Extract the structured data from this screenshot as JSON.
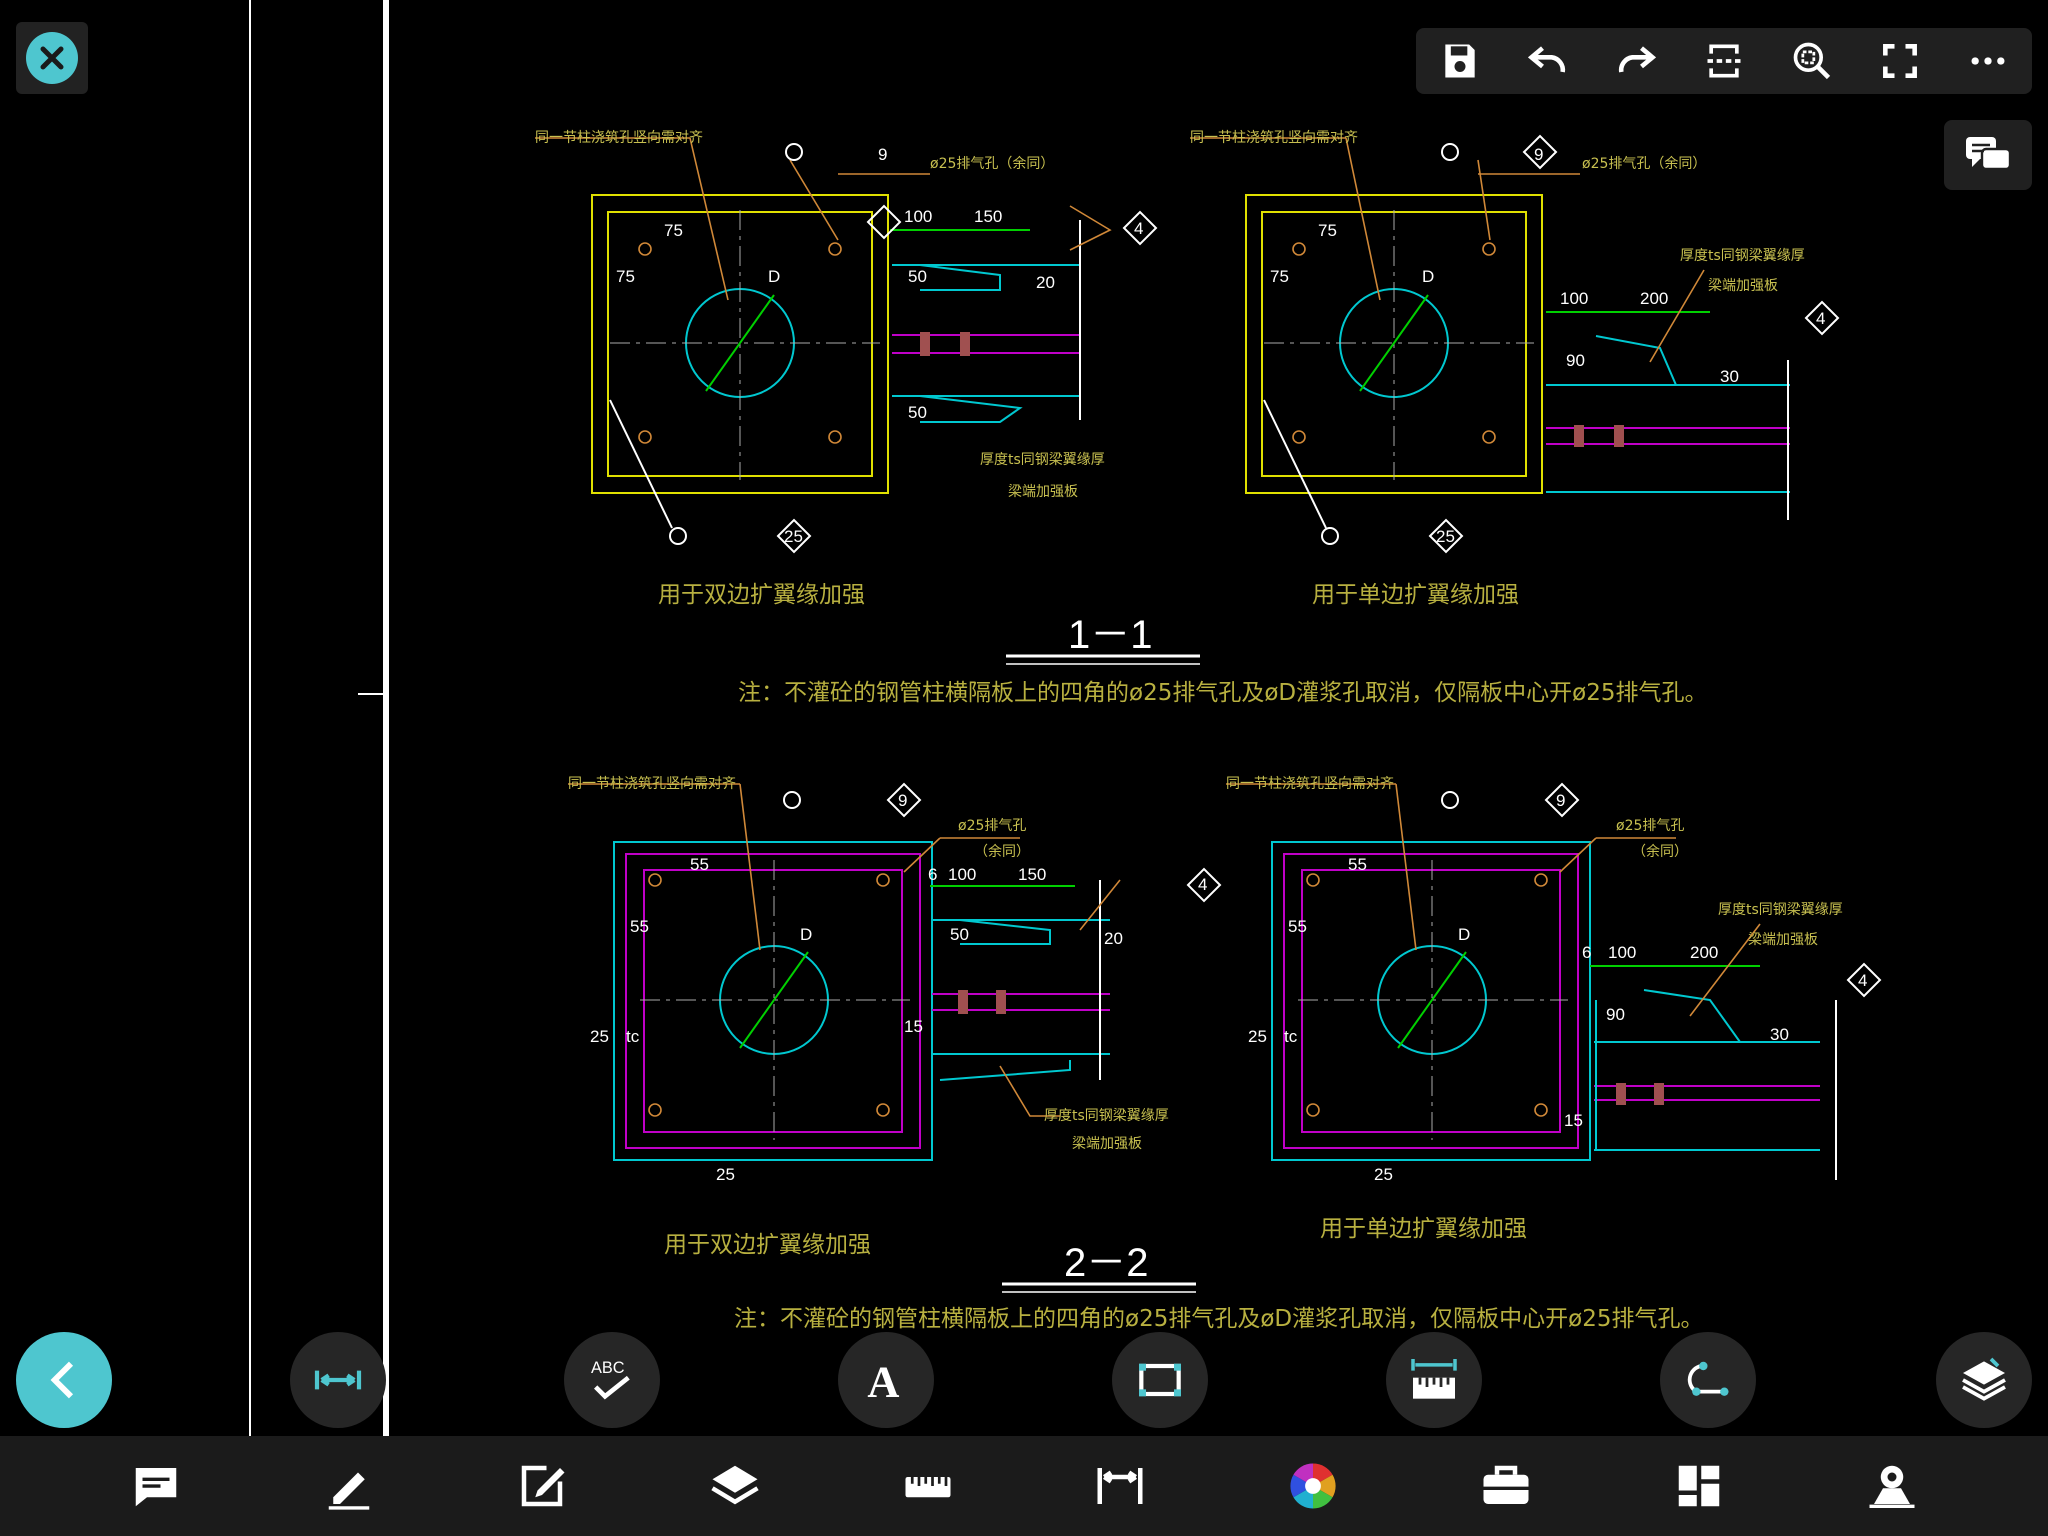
{
  "drawing": {
    "upper_left_title_note": "同一节柱浇筑孔竖向需对齐",
    "upper_left_vent_note": "ø25排气孔（余同）",
    "upper_right_title_note": "同一节柱浇筑孔竖向需对齐",
    "upper_right_vent_note": "ø25排气孔（余同）",
    "upper_right_plate_note1": "厚度ts同钢梁翼缘厚",
    "upper_right_plate_note2": "梁端加强板",
    "upper_left_plate_note1": "厚度ts同钢梁翼缘厚",
    "upper_left_plate_note2": "梁端加强板",
    "caption_double_1": "用于双边扩翼缘加强",
    "caption_single_1": "用于单边扩翼缘加强",
    "section_1": "1－1",
    "note_1": "注：不灌砼的钢管柱横隔板上的四角的ø25排气孔及øD灌浆孔取消，仅隔板中心开ø25排气孔。",
    "lower_left_title_note": "同一节柱浇筑孔竖向需对齐",
    "lower_left_vent_note1": "ø25排气孔",
    "lower_left_vent_note2": "（余同）",
    "lower_right_title_note": "同一节柱浇筑孔竖向需对齐",
    "lower_right_vent_note1": "ø25排气孔",
    "lower_right_vent_note2": "（余同）",
    "lower_left_plate_note1": "厚度ts同钢梁翼缘厚",
    "lower_left_plate_note2": "梁端加强板",
    "lower_right_plate_note1": "厚度ts同钢梁翼缘厚",
    "lower_right_plate_note2": "梁端加强板",
    "caption_double_2": "用于双边扩翼缘加强",
    "caption_single_2": "用于单边扩翼缘加强",
    "section_2": "2－2",
    "note_2": "注：不灌砼的钢管柱横隔板上的四角的ø25排气孔及øD灌浆孔取消，仅隔板中心开ø25排气孔。",
    "dims": {
      "d75": "75",
      "d100": "100",
      "d150": "150",
      "d50": "50",
      "d20": "20",
      "d200": "200",
      "d90": "90",
      "d30": "30",
      "d55": "55",
      "d25": "25",
      "d6": "6",
      "d15": "15",
      "tc": "tc",
      "D": "D",
      "tag9": "9",
      "tag4": "4",
      "tag25": "25"
    }
  },
  "toolbar": {
    "items": [
      "save-icon",
      "undo-icon",
      "redo-icon",
      "section-icon",
      "zoom-extent-icon",
      "fullscreen-icon",
      "more-icon"
    ]
  },
  "tools": [
    "measure-length-icon",
    "spell-check-icon",
    "text-icon",
    "rectangle-icon",
    "ruler-icon",
    "polyline-icon",
    "layers-3d-icon"
  ],
  "bottom_tabs": [
    "comment-icon",
    "pen-icon",
    "edit-icon",
    "layers-icon",
    "ruler-icon",
    "dimension-icon",
    "color-wheel-icon",
    "toolbox-icon",
    "grid-icon",
    "vr-icon"
  ],
  "colors": {
    "accent": "#4ec6cf",
    "yellow": "#e8e800",
    "cyan": "#00d0d8",
    "magenta": "#d000d8",
    "green": "#00e000",
    "orange": "#e09030",
    "text_yellow": "#b8b040"
  }
}
